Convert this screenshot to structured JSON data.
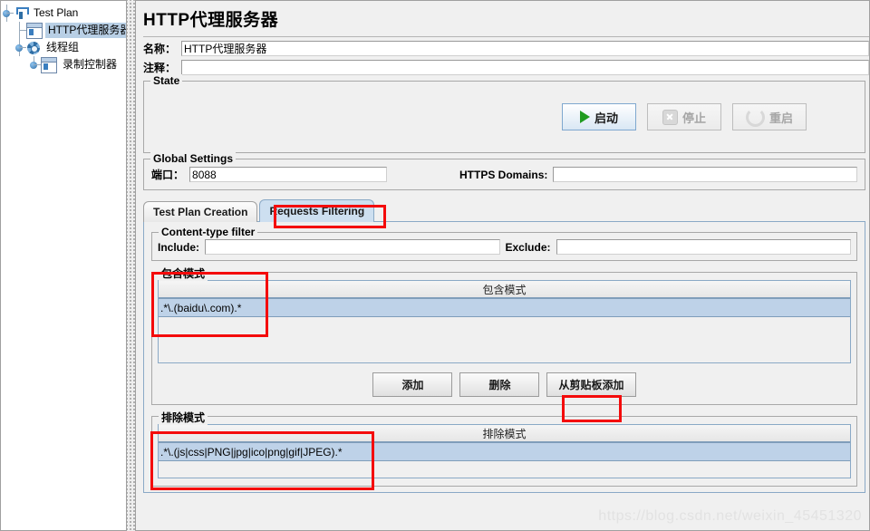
{
  "tree": {
    "nodes": [
      {
        "label": "Test Plan",
        "icon": "funnel-icon",
        "selected": false
      },
      {
        "label": "HTTP代理服务器",
        "icon": "window-icon",
        "selected": true
      },
      {
        "label": "线程组",
        "icon": "gear-icon",
        "selected": false
      },
      {
        "label": "录制控制器",
        "icon": "window-icon",
        "selected": false
      }
    ]
  },
  "main": {
    "title": "HTTP代理服务器",
    "name_label": "名称：",
    "name_value": "HTTP代理服务器",
    "comment_label": "注释：",
    "comment_value": "",
    "state": {
      "legend": "State",
      "start_label": "启动",
      "stop_label": "停止",
      "restart_label": "重启"
    },
    "global_settings": {
      "legend": "Global Settings",
      "port_label": "端口：",
      "port_value": "8088",
      "https_domains_label": "HTTPS Domains:",
      "https_domains_value": ""
    },
    "tabs": [
      {
        "label": "Test Plan Creation",
        "active": false
      },
      {
        "label": "Requests Filtering",
        "active": true
      }
    ],
    "content_type_filter": {
      "legend": "Content-type filter",
      "include_label": "Include:",
      "include_value": "",
      "exclude_label": "Exclude:",
      "exclude_value": ""
    },
    "include_patterns": {
      "legend": "包含模式",
      "column_header": "包含模式",
      "rows": [
        ".*\\.(baidu\\.com).*"
      ],
      "buttons": {
        "add": "添加",
        "delete": "删除",
        "add_from_clipboard": "从剪贴板添加"
      }
    },
    "exclude_patterns": {
      "legend": "排除模式",
      "column_header": "排除模式",
      "rows": [
        ".*\\.(js|css|PNG|jpg|ico|png|gif|JPEG).*"
      ]
    }
  },
  "watermark": "https://blog.csdn.net/weixin_45451320",
  "colors": {
    "annotation": "#f40b0b",
    "selection": "#bed2e8",
    "tab_active": "#cddff0",
    "start_green": "#1f9b1f"
  }
}
